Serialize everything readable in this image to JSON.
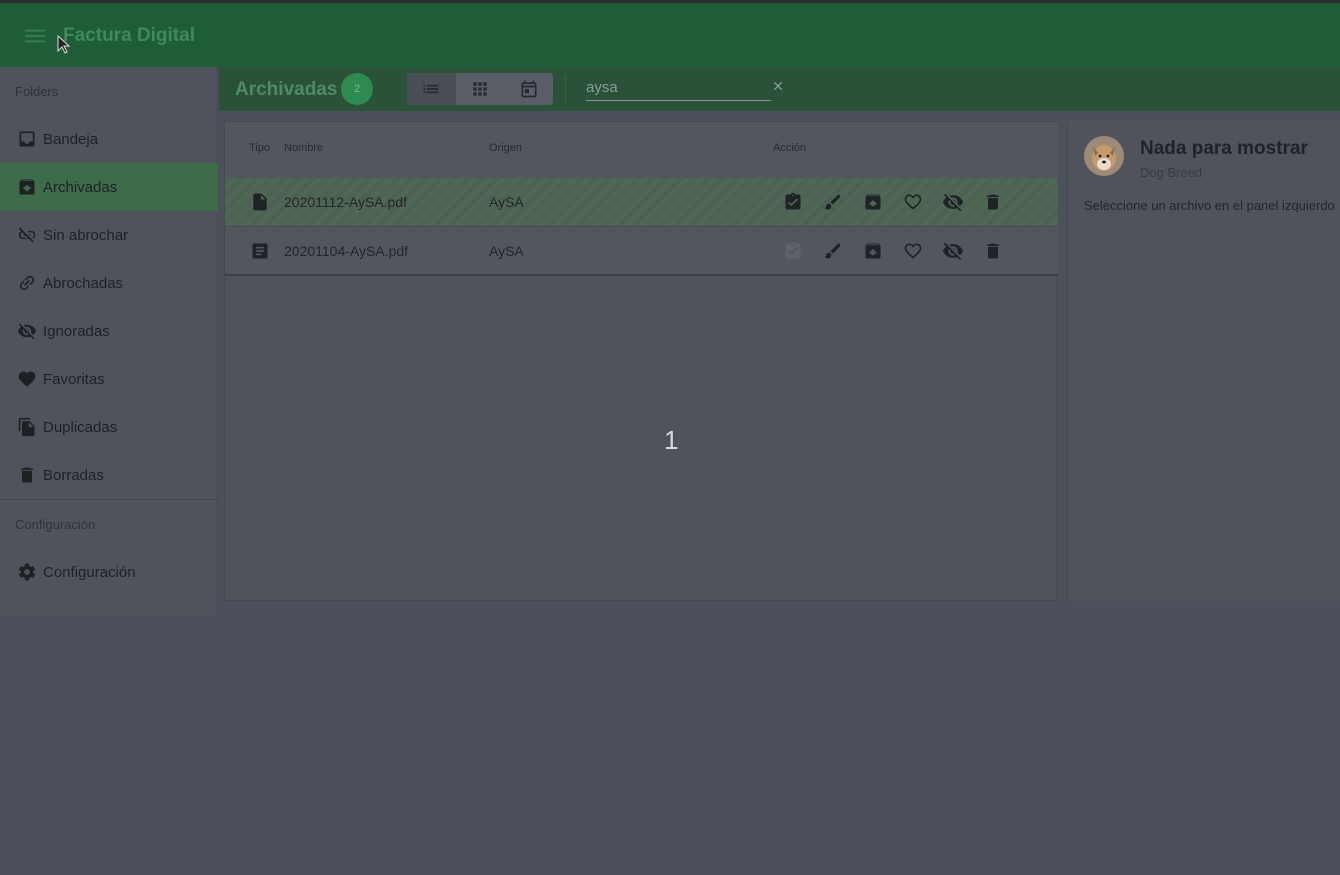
{
  "app": {
    "title": "Factura Digital"
  },
  "sidebar": {
    "section_folders": "Folders",
    "items": [
      {
        "label": "Bandeja",
        "icon": "inbox-icon"
      },
      {
        "label": "Archivadas",
        "icon": "archive-icon",
        "active": true
      },
      {
        "label": "Sin abrochar",
        "icon": "link-off-icon"
      },
      {
        "label": "Abrochadas",
        "icon": "link-icon"
      },
      {
        "label": "Ignoradas",
        "icon": "eye-off-icon"
      },
      {
        "label": "Favoritas",
        "icon": "heart-icon"
      },
      {
        "label": "Duplicadas",
        "icon": "copy-icon"
      },
      {
        "label": "Borradas",
        "icon": "trash-icon"
      }
    ],
    "section_config": "Configuración",
    "config_item": {
      "label": "Configuración",
      "icon": "gear-icon"
    }
  },
  "toolbar": {
    "folder_title": "Archivadas",
    "count": "2",
    "views": [
      "list-view-icon",
      "grid-view-icon",
      "calendar-view-icon"
    ],
    "search_value": "aysa"
  },
  "table": {
    "headers": {
      "tipo": "Tipo",
      "nombre": "Nombre",
      "origen": "Origen",
      "accion": "Acción"
    },
    "rows": [
      {
        "nombre": "20201112-AySA.pdf",
        "origen": "AySA",
        "tipo_icon": "file-icon",
        "selected": true
      },
      {
        "nombre": "20201104-AySA.pdf",
        "origen": "AySA",
        "tipo_icon": "document-lines-icon",
        "selected": false
      }
    ],
    "actions": [
      "check-clipboard-icon",
      "brush-icon",
      "unarchive-icon",
      "heart-outline-icon",
      "eye-off-icon",
      "trash-icon"
    ]
  },
  "overlay_number": "1",
  "detail": {
    "title": "Nada para mostrar",
    "subtitle": "Dog Breed",
    "message": "Seleccione un archivo en el panel izquierdo"
  },
  "colors": {
    "appbar": "#1f5c38",
    "accent": "#2f8a4f",
    "overlay": "#4b505a"
  }
}
